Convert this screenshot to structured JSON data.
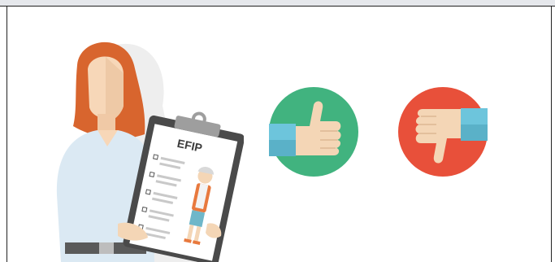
{
  "illustration": {
    "clipboard_title": "EFIP"
  },
  "buttons": {
    "like_icon": "thumbs-up-icon",
    "dislike_icon": "thumbs-down-icon"
  },
  "colors": {
    "like_bg": "#41b37f",
    "dislike_bg": "#e8503a",
    "sleeve": "#6dc5dc",
    "hand": "#f4d6b6",
    "hair": "#d8652e"
  }
}
